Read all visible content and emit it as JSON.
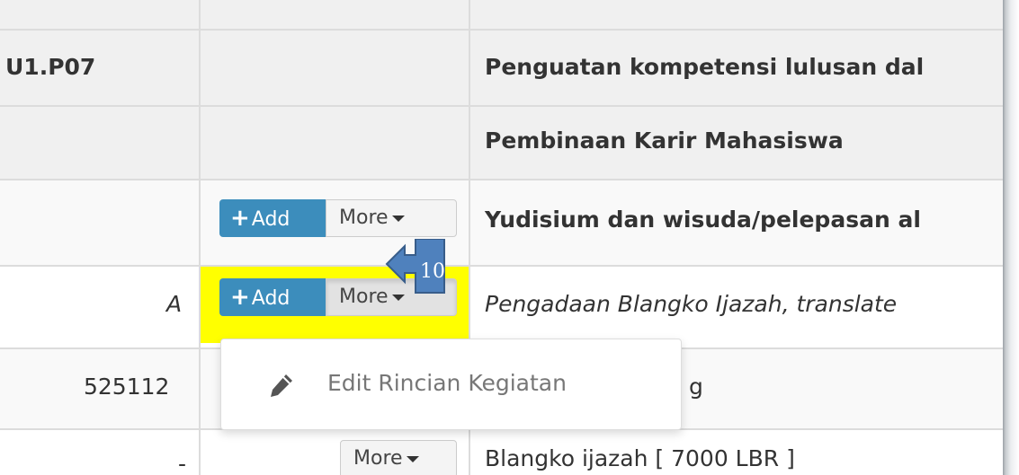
{
  "rows": [
    {
      "code": "U1.P07",
      "description": "Penguatan kompetensi lulusan dal"
    },
    {
      "code": "",
      "description": "Pembinaan Karir Mahasiswa"
    },
    {
      "code": "",
      "description": "Yudisium dan wisuda/pelepasan al"
    },
    {
      "code": "A",
      "description": "Pengadaan Blangko Ijazah, translate"
    },
    {
      "code": "525112",
      "description": "g"
    },
    {
      "code": "-",
      "description": "Blangko ijazah [ 7000 LBR ]"
    }
  ],
  "buttons": {
    "add_label": "Add",
    "more_label": "More"
  },
  "dropdown": {
    "items": [
      {
        "label": "Edit Rincian Kegiatan",
        "icon": "pencil-icon"
      }
    ]
  },
  "callout": {
    "number": "10",
    "color": "#4f81bd",
    "border_color": "#385d8a"
  },
  "colors": {
    "header_row_bg": "#f0f0f0",
    "stripe_row_bg": "#f9f9f9",
    "add_button_bg": "#3c8dbc",
    "highlight": "#ffff00",
    "grid_line": "#dcdcdc"
  }
}
